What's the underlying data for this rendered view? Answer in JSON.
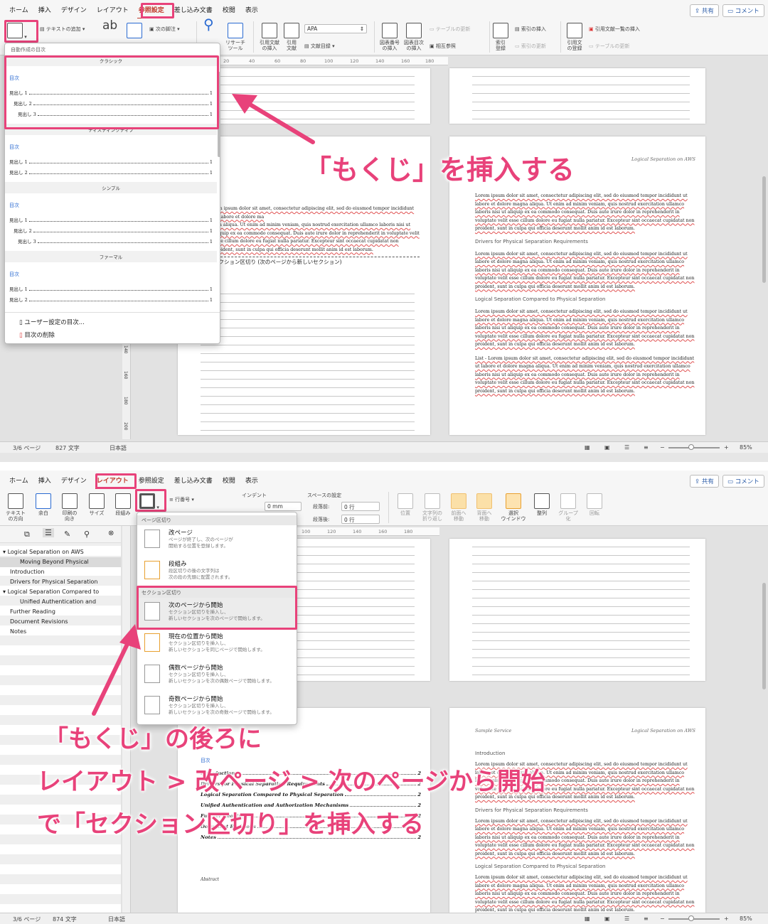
{
  "top": {
    "tabs": [
      "ホーム",
      "挿入",
      "デザイン",
      "レイアウト",
      "参照設定",
      "差し込み文書",
      "校閲",
      "表示"
    ],
    "active_tab": 4,
    "share_label": "共有",
    "comment_label": "コメント",
    "ribbon": {
      "add_text": "テキストの追加",
      "next_footnote": "次の脚注",
      "research_tool": "リサーチ\nツール",
      "insert_citation": "引用文献\nの挿入",
      "citation": "引用\n文献",
      "style_value": "APA",
      "bibliography": "文献目録",
      "insert_caption": "図表番号\nの挿入",
      "insert_table_of_figures": "図表目次\nの挿入",
      "update_table": "テーブルの更新",
      "cross_reference": "相互参照",
      "mark_entry": "索引\n登録",
      "insert_index": "索引の挿入",
      "update_index": "索引の更新",
      "mark_citation": "引用文\nの登録",
      "insert_table_of_authorities": "引用文献一覧の挿入",
      "update_table2": "テーブルの更新"
    },
    "ruler_ticks": [
      "20",
      "40",
      "60",
      "80",
      "100",
      "120",
      "140",
      "160",
      "180"
    ],
    "vruler_ticks": [
      "140",
      "160",
      "180",
      "200"
    ],
    "dropdown": {
      "header": "自動作成の目次",
      "styles": [
        {
          "label": "クラシック"
        },
        {
          "label": "ディスティンクティブ"
        },
        {
          "label": "シンプル"
        },
        {
          "label": "ファーマル"
        }
      ],
      "toc_title": "目次",
      "heading1": "見出し 1",
      "heading2": "見出し 2",
      "heading3": "見出し 3",
      "page_num": "1",
      "custom_toc": "ユーザー設定の目次...",
      "remove_toc": "目次の削除"
    },
    "doc": {
      "running_header": "Logical Separation on AWS",
      "section_break": "セクション区切り (次のページから新しいセクション)",
      "lorem": "Lorem ipsum dolor sit amet, consectetur adipiscing elit, sed do eiusmod tempor incididunt ut labore et dolore magna aliqua. Ut enim ad minim veniam, quis nostrud exercitation ullamco laboris nisi ut aliquip ex ea commodo consequat. Duis aute irure dolor in reprehenderit in voluptate velit esse cillum dolore eu fugiat nulla pariatur. Excepteur sint occaecat cupidatat non proident, sunt in culpa qui officia deserunt mollit anim id est laborum.",
      "lorem_left": "gna aliqua. Ut enim ad minim veniam, quis nostrud exercitation ullamco laboris nisi ut aliquip ex ea commodo consequat. Duis aute irure dolor in reprehenderit in voluptate velit esse cillum dolore eu fugiat nulla pariatur. Excepteur sint occaecat cupidatat non proident, sunt in culpa qui officia deserunt mollit anim id est laborum.",
      "lorem_left_first": "rem ipsum dolor sit amet, consectetur adipiscing elit, sed do eiusmod tempor incididunt ut labore et dolore ma",
      "heading_a": "Drivers for Physical Separation Requirements",
      "heading_b": "Logical Separation Compared to Physical Separation",
      "list_lorem": "List - Lorem ipsum dolor sit amet, consectetur adipiscing elit, sed do eiusmod tempor incididunt ut labore et dolore magna aliqua. Ut enim ad minim veniam, quis nostrud exercitation ullamco laboris nisi ut aliquip ex ea commodo consequat. Duis aute irure dolor in reprehenderit in voluptate velit esse cillum dolore eu fugiat nulla pariatur. Excepteur sint occaecat cupidatat non proident, sunt in culpa qui officia deserunt mollit anim id est laborum."
    },
    "status": {
      "page": "3/6 ページ",
      "words": "827 文字",
      "lang": "日本語",
      "zoom": "85%"
    },
    "callout": "「もくじ」を挿入する"
  },
  "bottom": {
    "tabs": [
      "ホーム",
      "挿入",
      "デザイン",
      "レイアウト",
      "参照設定",
      "差し込み文書",
      "校閲",
      "表示"
    ],
    "active_tab": 3,
    "share_label": "共有",
    "comment_label": "コメント",
    "ribbon": {
      "text_direction": "テキスト\nの方向",
      "margins": "余白",
      "orientation": "印刷の\n向き",
      "size": "サイズ",
      "columns": "段組み",
      "line_numbers": "行番号",
      "indent": "インデント",
      "spacing": "スペースの設定",
      "indent_left": "0 mm",
      "before_label": "段落前:",
      "after_label": "段落後:",
      "before_value": "0 行",
      "after_value": "0 行",
      "position": "位置",
      "wrap": "文字列の\n折り返し",
      "bring_forward": "前面へ\n移動",
      "send_backward": "背面へ\n移動",
      "selection_pane": "選択\nウインドウ",
      "align": "整列",
      "group": "グループ\n化",
      "rotate": "回転"
    },
    "nav": [
      "Logical Separation on AWS",
      "Moving Beyond Physical",
      "Introduction",
      "Drivers for Physical Separation",
      "Logical Separation Compared to",
      "Unified Authentication and",
      "Further Reading",
      "Document Revisions",
      "Notes"
    ],
    "dropdown": {
      "page_break_header": "ページ区切り",
      "section_break_header": "セクション区切り",
      "items": [
        {
          "title": "改ページ",
          "desc": "ページが終了し、次のページが\n開始する位置を登録します。"
        },
        {
          "title": "段組み",
          "desc": "段区切りの後の文字列は\n次の段の先頭に配置されます。"
        },
        {
          "title": "次のページから開始",
          "desc": "セクション区切りを挿入し、\n新しいセクションを次のページで開始します。"
        },
        {
          "title": "現在の位置から開始",
          "desc": "セクション区切りを挿入し、\n新しいセクションを同じページで開始します。"
        },
        {
          "title": "偶数ページから開始",
          "desc": "セクション区切りを挿入し、\n新しいセクションを次の偶数ページで開始します。"
        },
        {
          "title": "奇数ページから開始",
          "desc": "セクション区切りを挿入し、\n新しいセクションを次の奇数ページで開始します。"
        }
      ]
    },
    "doc": {
      "header_left": "Sample Service",
      "header_right": "Logical Separation on AWS",
      "toc_title": "目次",
      "toc_rows": [
        "Introduction",
        "Drivers for Physical Separation Requirements",
        "Logical Separation Compared to Physical Separation",
        "Unified Authentication and Authorization Mechanisms",
        "Further Reading",
        "Document Revisions",
        "Notes"
      ],
      "toc_page": "2",
      "abstract": "Abstract",
      "heading_intro": "Introduction",
      "heading_a": "Drivers for Physical Separation Requirements",
      "heading_b": "Logical Separation Compared to Physical Separation",
      "lorem": "Lorem ipsum dolor sit amet, consectetur adipiscing elit, sed do eiusmod tempor incididunt ut labore et dolore magna aliqua. Ut enim ad minim veniam, quis nostrud exercitation ullamco laboris nisi ut aliquip ex ea commodo consequat. Duis aute irure dolor in reprehenderit in voluptate velit esse cillum dolore eu fugiat nulla pariatur. Excepteur sint occaecat cupidatat non proident, sunt in culpa qui officia deserunt mollit anim id est laborum."
    },
    "status": {
      "page": "3/6 ページ",
      "words": "874 文字",
      "lang": "日本語",
      "zoom": "85%"
    },
    "callout_line1": "「もくじ」の後ろに",
    "callout_line2": "レイアウト > 改ページ > 次のページから開始",
    "callout_line3": "で「セクション区切り」を挿入する"
  },
  "colors": {
    "accent_pink": "#e8427a",
    "active_tab": "#c0392b",
    "link_blue": "#2a6ad1"
  }
}
